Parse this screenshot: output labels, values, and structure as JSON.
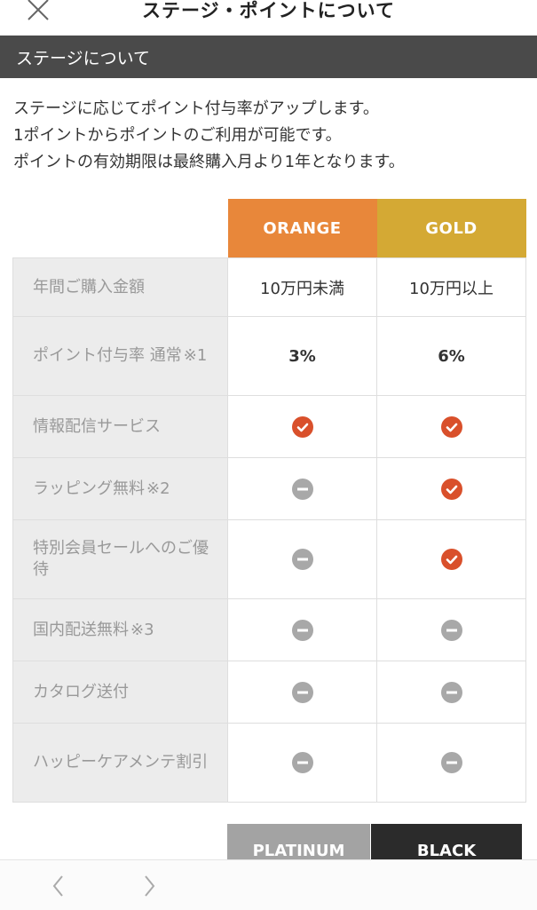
{
  "header": {
    "title": "ステージ・ポイントについて"
  },
  "section": {
    "title": "ステージについて"
  },
  "intro": [
    "ステージに応じてポイント付与率がアップします。",
    "1ポイントからポイントのご利用が可能です。",
    "ポイントの有効期限は最終購入月より1年となります。"
  ],
  "table": {
    "stages": [
      {
        "name": "ORANGE",
        "color": "#e8873a"
      },
      {
        "name": "GOLD",
        "color": "#d4a934"
      }
    ],
    "rows": [
      {
        "label": "年間ご購入金額",
        "orange": "10万円未満",
        "gold": "10万円以上"
      },
      {
        "label": "ポイント付与率 通常",
        "note": "※1",
        "orange": "3%",
        "gold": "6%"
      },
      {
        "label": "情報配信サービス",
        "orange": "check-icon",
        "gold": "check-icon"
      },
      {
        "label": "ラッピング無料",
        "note": "※2",
        "orange": "minus-icon",
        "gold": "check-icon"
      },
      {
        "label": "特別会員セールへのご優待",
        "orange": "minus-icon",
        "gold": "check-icon"
      },
      {
        "label": "国内配送無料",
        "note": "※3",
        "orange": "minus-icon",
        "gold": "minus-icon"
      },
      {
        "label": "カタログ送付",
        "orange": "minus-icon",
        "gold": "minus-icon"
      },
      {
        "label": "ハッピーケアメンテ割引",
        "orange": "minus-icon",
        "gold": "minus-icon"
      }
    ]
  },
  "next_stages": [
    {
      "name": "PLATINUM",
      "color": "#a3a3a3"
    },
    {
      "name": "BLACK",
      "color": "#2b2b2b"
    }
  ],
  "icons": {
    "check": {
      "name": "check-icon",
      "color": "#d9502b"
    },
    "minus": {
      "name": "minus-icon",
      "color": "#a8a8a8"
    },
    "close": "close-icon",
    "back": "chevron-left-icon",
    "forward": "chevron-right-icon"
  }
}
